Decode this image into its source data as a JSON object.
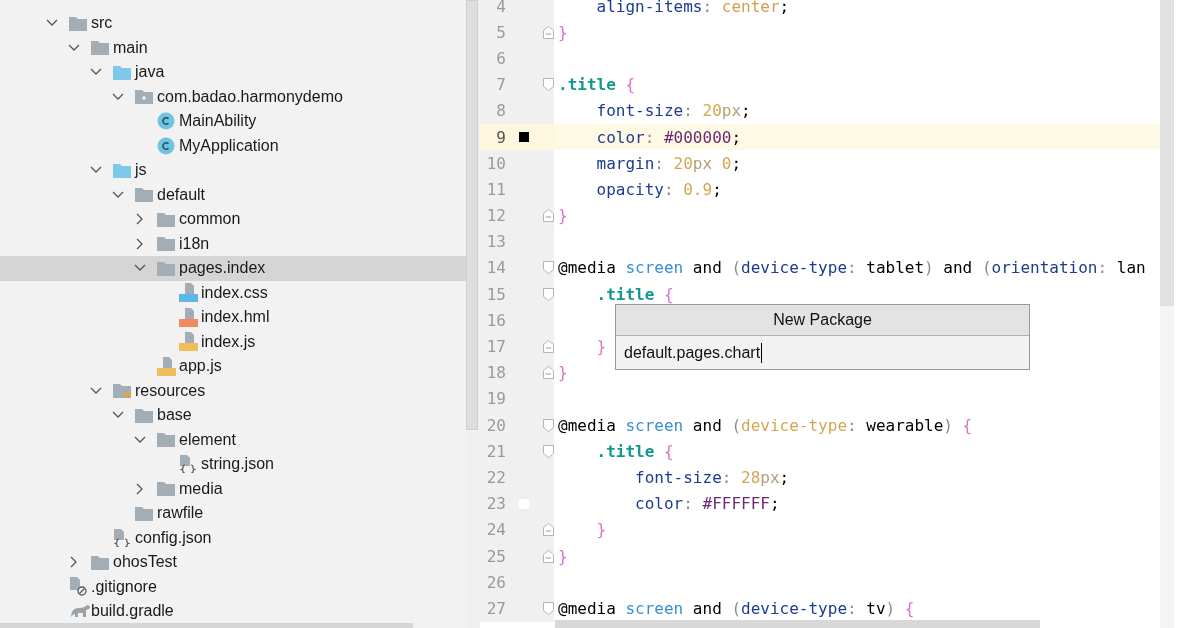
{
  "project_tree": [
    {
      "label": "src",
      "kind": "folder",
      "expanded": true,
      "selected": false,
      "children": [
        {
          "label": "main",
          "kind": "folder",
          "expanded": true,
          "selected": false,
          "children": [
            {
              "label": "java",
              "kind": "source-folder",
              "expanded": true,
              "selected": false,
              "children": [
                {
                  "label": "com.badao.harmonydemo",
                  "kind": "package",
                  "expanded": true,
                  "selected": false,
                  "children": [
                    {
                      "label": "MainAbility",
                      "kind": "class",
                      "selected": false
                    },
                    {
                      "label": "MyApplication",
                      "kind": "class",
                      "selected": false
                    }
                  ]
                }
              ]
            },
            {
              "label": "js",
              "kind": "source-folder",
              "expanded": true,
              "selected": false,
              "children": [
                {
                  "label": "default",
                  "kind": "folder",
                  "expanded": true,
                  "selected": false,
                  "children": [
                    {
                      "label": "common",
                      "kind": "folder",
                      "expanded": false,
                      "selected": false
                    },
                    {
                      "label": "i18n",
                      "kind": "folder",
                      "expanded": false,
                      "selected": false
                    },
                    {
                      "label": "pages.index",
                      "kind": "folder",
                      "expanded": true,
                      "selected": true,
                      "children": [
                        {
                          "label": "index.css",
                          "kind": "css",
                          "selected": false
                        },
                        {
                          "label": "index.hml",
                          "kind": "hml",
                          "selected": false
                        },
                        {
                          "label": "index.js",
                          "kind": "js",
                          "selected": false
                        }
                      ]
                    },
                    {
                      "label": "app.js",
                      "kind": "js",
                      "selected": false
                    }
                  ]
                }
              ]
            },
            {
              "label": "resources",
              "kind": "resources-folder",
              "expanded": true,
              "selected": false,
              "children": [
                {
                  "label": "base",
                  "kind": "folder",
                  "expanded": true,
                  "selected": false,
                  "children": [
                    {
                      "label": "element",
                      "kind": "folder",
                      "expanded": true,
                      "selected": false,
                      "children": [
                        {
                          "label": "string.json",
                          "kind": "json",
                          "selected": false
                        }
                      ]
                    },
                    {
                      "label": "media",
                      "kind": "folder",
                      "expanded": false,
                      "selected": false
                    }
                  ]
                },
                {
                  "label": "rawfile",
                  "kind": "folder",
                  "selected": false
                }
              ]
            },
            {
              "label": "config.json",
              "kind": "json",
              "selected": false
            }
          ]
        },
        {
          "label": "ohosTest",
          "kind": "folder",
          "expanded": false,
          "selected": false
        }
      ]
    },
    {
      "label": ".gitignore",
      "kind": "gitignore",
      "selected": false
    },
    {
      "label": "build.gradle",
      "kind": "gradle",
      "selected": false
    }
  ],
  "editor": {
    "lines": [
      {
        "number": "4",
        "tokens": [
          {
            "text": "    align-items",
            "kind": "prop"
          },
          {
            "text": ": ",
            "kind": "punct"
          },
          {
            "text": "center",
            "kind": "value"
          },
          {
            "text": ";",
            "kind": "plain"
          }
        ]
      },
      {
        "number": "5",
        "fold": {
          "kind": "close"
        },
        "tokens": [
          {
            "text": "}",
            "kind": "brace"
          }
        ]
      },
      {
        "number": "6"
      },
      {
        "number": "7",
        "fold": {
          "kind": "open"
        },
        "tokens": [
          {
            "text": ".title",
            "kind": "sel"
          },
          {
            "text": " {",
            "kind": "brace"
          }
        ]
      },
      {
        "number": "8",
        "tokens": [
          {
            "text": "    font-size",
            "kind": "prop"
          },
          {
            "text": ": ",
            "kind": "punct"
          },
          {
            "text": "20",
            "kind": "num"
          },
          {
            "text": "px",
            "kind": "unit"
          },
          {
            "text": ";",
            "kind": "plain"
          }
        ]
      },
      {
        "number": "9",
        "current": true,
        "color": "#000000",
        "tokens": [
          {
            "text": "    color",
            "kind": "prop"
          },
          {
            "text": ": ",
            "kind": "punct"
          },
          {
            "text": "#000000",
            "kind": "hex"
          },
          {
            "text": ";",
            "kind": "plain"
          }
        ]
      },
      {
        "number": "10",
        "tokens": [
          {
            "text": "    margin",
            "kind": "prop"
          },
          {
            "text": ": ",
            "kind": "punct"
          },
          {
            "text": "20",
            "kind": "num"
          },
          {
            "text": "px",
            "kind": "unit"
          },
          {
            "text": " 0",
            "kind": "num"
          },
          {
            "text": ";",
            "kind": "plain"
          }
        ]
      },
      {
        "number": "11",
        "tokens": [
          {
            "text": "    opacity",
            "kind": "prop"
          },
          {
            "text": ": ",
            "kind": "punct"
          },
          {
            "text": "0.9",
            "kind": "num"
          },
          {
            "text": ";",
            "kind": "plain"
          }
        ]
      },
      {
        "number": "12",
        "fold": {
          "kind": "close"
        },
        "tokens": [
          {
            "text": "}",
            "kind": "brace"
          }
        ]
      },
      {
        "number": "13"
      },
      {
        "number": "14",
        "fold": {
          "kind": "open"
        },
        "tokens": [
          {
            "text": "@media",
            "kind": "at"
          },
          {
            "text": " screen",
            "kind": "media"
          },
          {
            "text": " and ",
            "kind": "kw"
          },
          {
            "text": "(",
            "kind": "punct"
          },
          {
            "text": "device-type",
            "kind": "prop"
          },
          {
            "text": ": ",
            "kind": "punct"
          },
          {
            "text": "tablet",
            "kind": "ident"
          },
          {
            "text": ")",
            "kind": "punct"
          },
          {
            "text": " and ",
            "kind": "kw"
          },
          {
            "text": "(",
            "kind": "punct"
          },
          {
            "text": "orientation",
            "kind": "prop"
          },
          {
            "text": ": ",
            "kind": "punct"
          },
          {
            "text": "lan",
            "kind": "ident"
          }
        ]
      },
      {
        "number": "15",
        "fold": {
          "kind": "open"
        },
        "tokens": [
          {
            "text": "    .title",
            "kind": "sel"
          },
          {
            "text": " {",
            "kind": "brace"
          }
        ]
      },
      {
        "number": "16"
      },
      {
        "number": "17",
        "fold": {
          "kind": "close"
        },
        "tokens": [
          {
            "text": "    }",
            "kind": "brace"
          }
        ]
      },
      {
        "number": "18",
        "fold": {
          "kind": "close"
        },
        "tokens": [
          {
            "text": "}",
            "kind": "brace"
          }
        ]
      },
      {
        "number": "19"
      },
      {
        "number": "20",
        "fold": {
          "kind": "open"
        },
        "tokens": [
          {
            "text": "@media",
            "kind": "at"
          },
          {
            "text": " screen",
            "kind": "media"
          },
          {
            "text": " and ",
            "kind": "kw"
          },
          {
            "text": "(",
            "kind": "punct"
          },
          {
            "text": "device-type",
            "kind": "prop-alt"
          },
          {
            "text": ": ",
            "kind": "punct"
          },
          {
            "text": "wearable",
            "kind": "ident"
          },
          {
            "text": ")",
            "kind": "punct"
          },
          {
            "text": " {",
            "kind": "brace"
          }
        ]
      },
      {
        "number": "21",
        "fold": {
          "kind": "open"
        },
        "tokens": [
          {
            "text": "    .title",
            "kind": "sel"
          },
          {
            "text": " {",
            "kind": "brace"
          }
        ]
      },
      {
        "number": "22",
        "tokens": [
          {
            "text": "        font-size",
            "kind": "prop"
          },
          {
            "text": ": ",
            "kind": "punct"
          },
          {
            "text": "28",
            "kind": "num"
          },
          {
            "text": "px",
            "kind": "unit"
          },
          {
            "text": ";",
            "kind": "plain"
          }
        ]
      },
      {
        "number": "23",
        "color": "#ffffff",
        "tokens": [
          {
            "text": "        color",
            "kind": "prop"
          },
          {
            "text": ": ",
            "kind": "punct"
          },
          {
            "text": "#FFFFFF",
            "kind": "hex"
          },
          {
            "text": ";",
            "kind": "plain"
          }
        ]
      },
      {
        "number": "24",
        "fold": {
          "kind": "close"
        },
        "tokens": [
          {
            "text": "    }",
            "kind": "brace"
          }
        ]
      },
      {
        "number": "25",
        "fold": {
          "kind": "close"
        },
        "tokens": [
          {
            "text": "}",
            "kind": "brace"
          }
        ]
      },
      {
        "number": "26"
      },
      {
        "number": "27",
        "fold": {
          "kind": "open"
        },
        "tokens": [
          {
            "text": "@media",
            "kind": "at"
          },
          {
            "text": " screen",
            "kind": "media"
          },
          {
            "text": " and ",
            "kind": "kw"
          },
          {
            "text": "(",
            "kind": "punct"
          },
          {
            "text": "device-type",
            "kind": "prop"
          },
          {
            "text": ": ",
            "kind": "punct"
          },
          {
            "text": "tv",
            "kind": "ident"
          },
          {
            "text": ")",
            "kind": "punct"
          },
          {
            "text": " {",
            "kind": "brace"
          }
        ]
      }
    ]
  },
  "dialog": {
    "title": "New Package",
    "value": "default.pages.chart"
  }
}
